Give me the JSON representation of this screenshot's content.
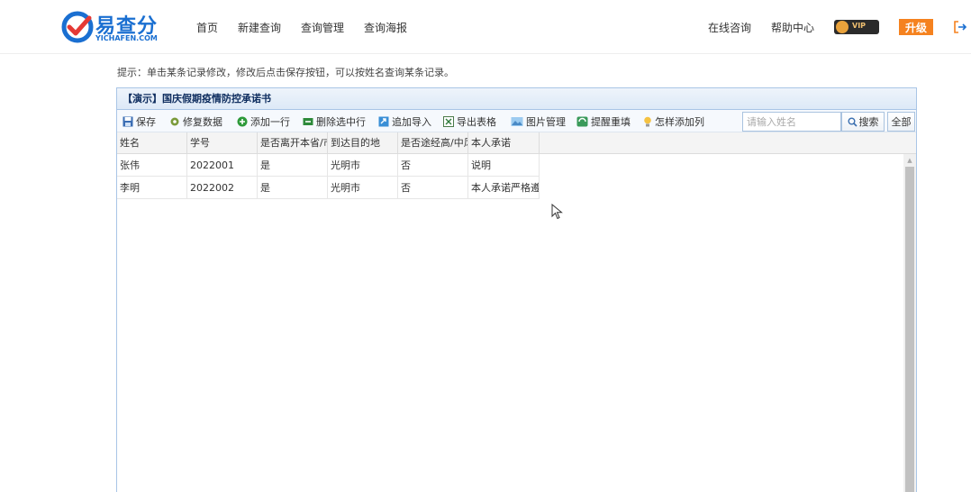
{
  "header": {
    "logo_text": "易查分",
    "logo_sub": "YICHAFEN.COM",
    "nav": [
      {
        "label": "首页"
      },
      {
        "label": "新建查询"
      },
      {
        "label": "查询管理"
      },
      {
        "label": "查询海报"
      }
    ],
    "online_consult": "在线咨询",
    "help_center": "帮助中心",
    "vip_label": "VIP",
    "upgrade_label": "升级"
  },
  "hint": "提示：单击某条记录修改，修改后点击保存按钮，可以按姓名查询某条记录。",
  "panel": {
    "title": "【演示】国庆假期疫情防控承诺书",
    "toolbar": {
      "save": "保存",
      "repair": "修复数据",
      "add_row": "添加一行",
      "delete_row": "删除选中行",
      "append_import": "追加导入",
      "export": "导出表格",
      "image_manage": "图片管理",
      "remind": "提醒重填",
      "how_add_col": "怎样添加列",
      "search_placeholder": "请输入姓名",
      "search_label": "搜索",
      "all_label": "全部"
    },
    "columns": [
      "姓名",
      "学号",
      "是否离开本省/市",
      "到达目的地",
      "是否途经高/中风险地区",
      "本人承诺"
    ],
    "rows": [
      [
        "张伟",
        "2022001",
        "是",
        "光明市",
        "否",
        "说明"
      ],
      [
        "李明",
        "2022002",
        "是",
        "光明市",
        "否",
        "本人承诺严格遵守"
      ]
    ]
  },
  "colors": {
    "brand": "#1a6fd1",
    "upgrade": "#f5821f",
    "panel_border": "#a9c5e6",
    "title_text": "#0e2d5f"
  }
}
